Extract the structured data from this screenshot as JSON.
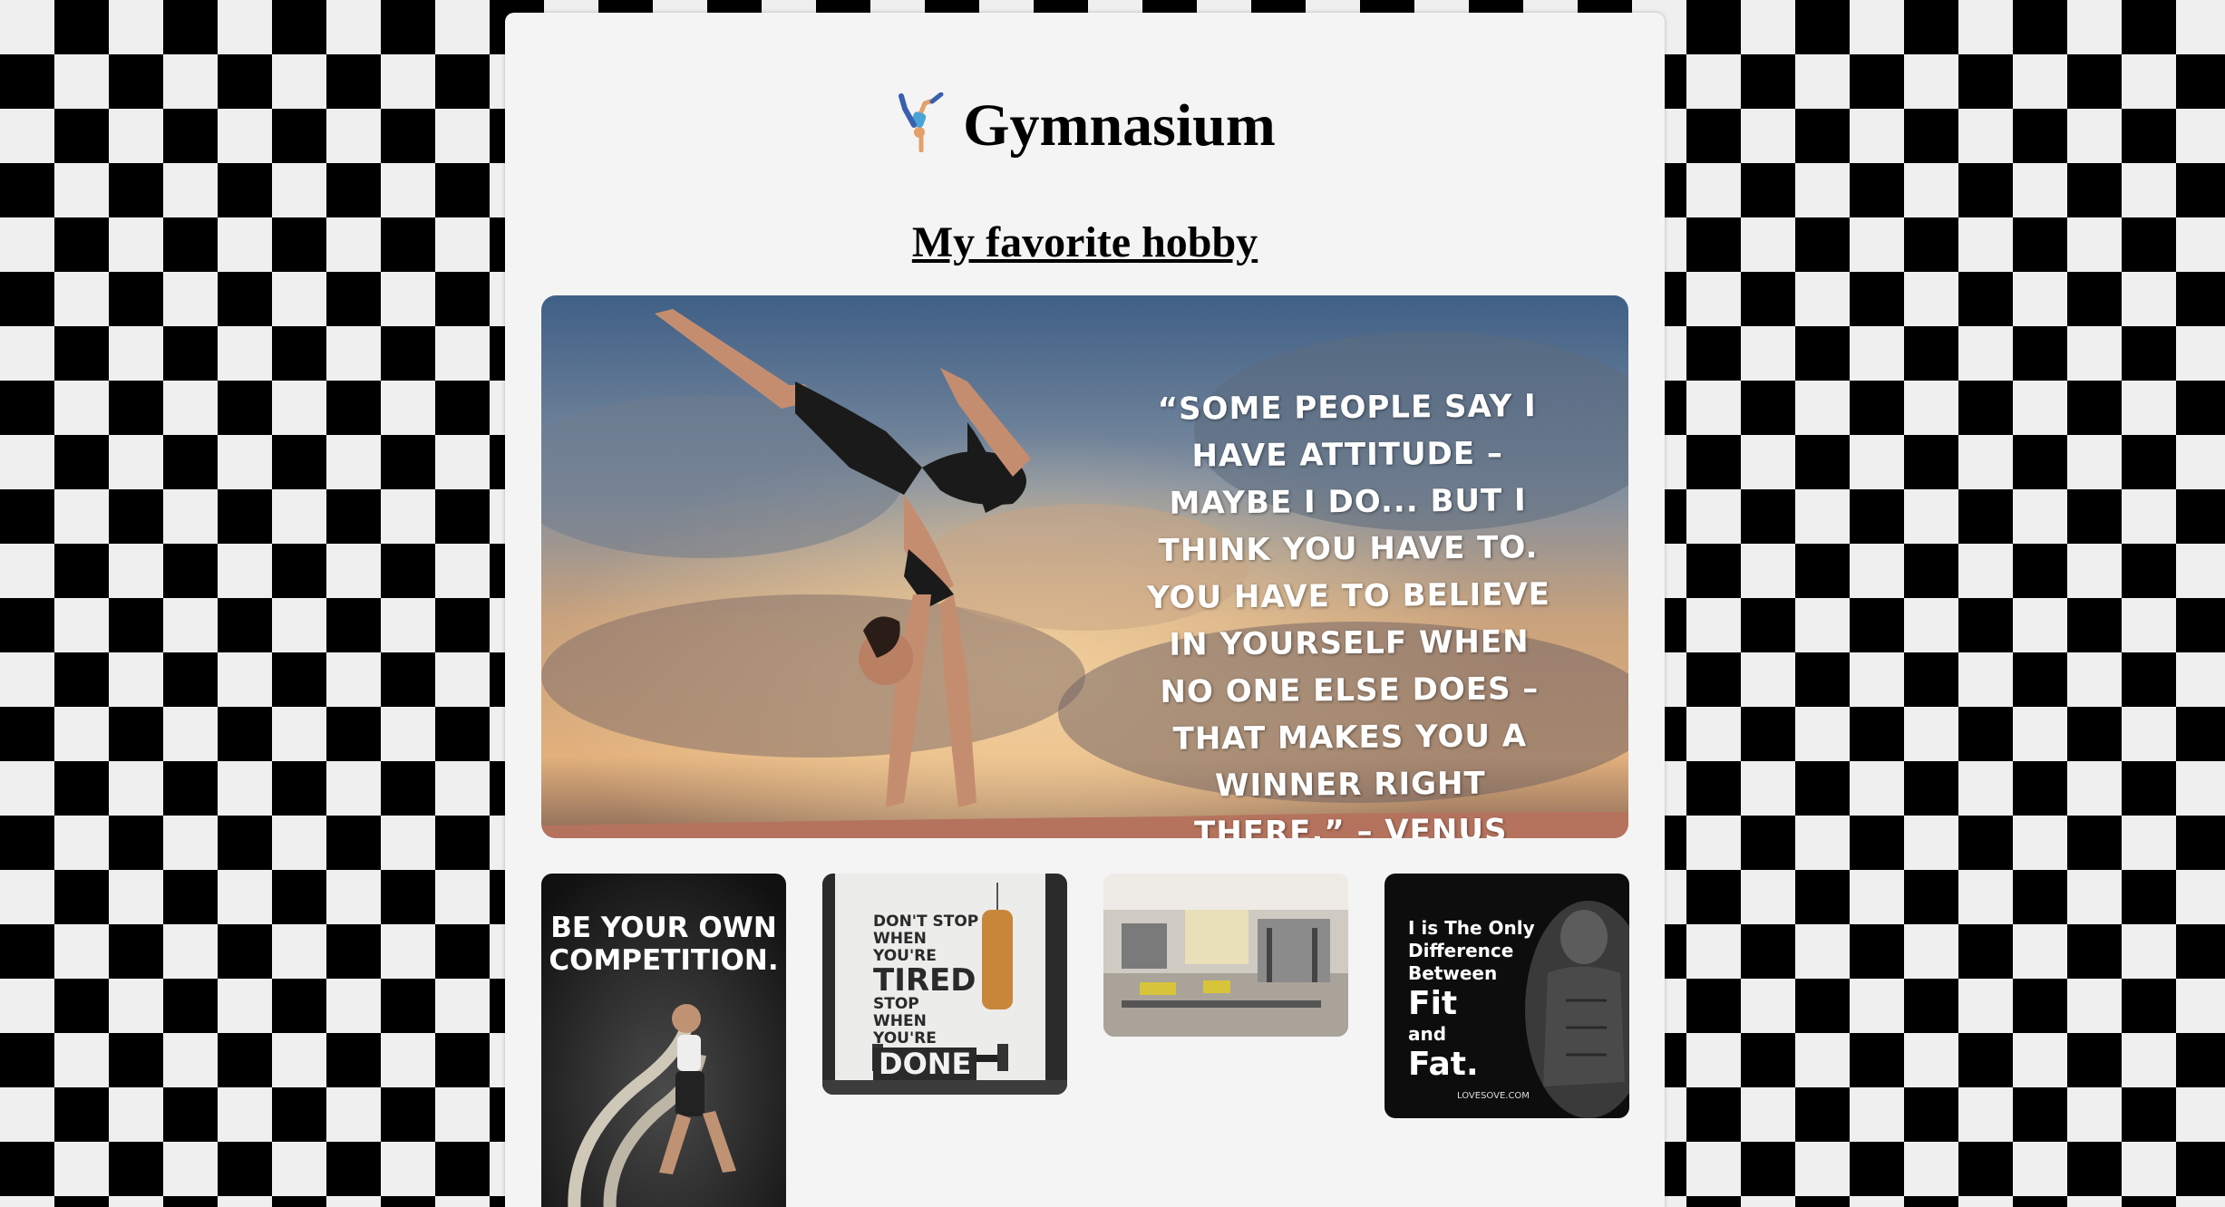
{
  "header": {
    "icon": "person-doing-cartwheel-emoji",
    "title": "Gymnasium",
    "subtitle": "My favorite hobby"
  },
  "hero": {
    "quote": "“SOME PEOPLE SAY I HAVE ATTITUDE – MAYBE I DO... BUT I THINK YOU HAVE TO. YOU HAVE TO BELIEVE IN YOURSELF WHEN NO ONE ELSE DOES – THAT MAKES YOU A WINNER RIGHT THERE.” – VENUS WILLIAMS"
  },
  "gallery": {
    "poster1": "BE YOUR OWN COMPETITION.",
    "poster2": {
      "line1": "DON'T STOP",
      "line2": "WHEN YOU'RE",
      "line3": "TIRED",
      "line4": "STOP",
      "line5": "WHEN YOU'RE",
      "line6": "DONE"
    },
    "poster4": {
      "line1": "I is The Only",
      "line2": "Difference",
      "line3": "Between",
      "line4": "Fit",
      "line5": "and",
      "line6": "Fat.",
      "site": "LOVESOVE.COM"
    }
  },
  "colors": {
    "card_bg": "#f4f4f4",
    "checker_dark": "#000000",
    "checker_light": "#efefef"
  }
}
